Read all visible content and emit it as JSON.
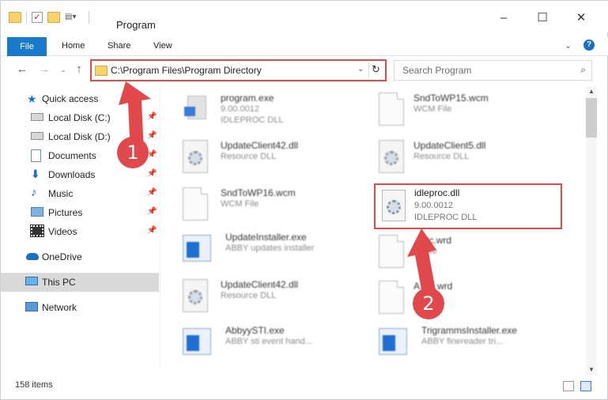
{
  "window": {
    "title": "Program",
    "controls": {
      "minimize": "–",
      "maximize": "☐",
      "close": "✕"
    }
  },
  "ribbon": {
    "tabs": [
      "File",
      "Home",
      "Share",
      "View"
    ],
    "help": "?"
  },
  "address": {
    "path": "C:\\Program Files\\Program Directory"
  },
  "search": {
    "placeholder": "Search Program"
  },
  "sidebar": {
    "items": [
      {
        "label": "Quick access",
        "icon": "star-icon"
      },
      {
        "label": "Local Disk (C:)",
        "icon": "drive-icon",
        "pinned": true
      },
      {
        "label": "Local Disk (D:)",
        "icon": "drive-icon",
        "pinned": true
      },
      {
        "label": "Documents",
        "icon": "documents-icon",
        "pinned": true
      },
      {
        "label": "Downloads",
        "icon": "downloads-icon",
        "pinned": true
      },
      {
        "label": "Music",
        "icon": "music-icon",
        "pinned": true
      },
      {
        "label": "Pictures",
        "icon": "pictures-icon",
        "pinned": true
      },
      {
        "label": "Videos",
        "icon": "videos-icon",
        "pinned": true
      },
      {
        "label": "OneDrive",
        "icon": "cloud-icon"
      },
      {
        "label": "This PC",
        "icon": "computer-icon",
        "selected": true
      },
      {
        "label": "Network",
        "icon": "network-icon"
      }
    ]
  },
  "files": [
    {
      "name": "program.exe",
      "line1": "9.00.0012",
      "line2": "IDLEPROC DLL",
      "icon": "exe-icon"
    },
    {
      "name": "SndToWP15.wcm",
      "line1": "WCM File",
      "line2": "",
      "icon": "document-icon"
    },
    {
      "name": "UpdateClient42.dll",
      "line1": "Resource DLL",
      "line2": "",
      "icon": "dll-icon"
    },
    {
      "name": "UpdateClient5.dll",
      "line1": "Resource DLL",
      "line2": "",
      "icon": "dll-icon"
    },
    {
      "name": "SndToWP16.wcm",
      "line1": "WCM File",
      "line2": "",
      "icon": "document-icon"
    },
    {
      "name": "UpdateInstaller.exe",
      "line1": "ABBY updates installer",
      "line2": "",
      "icon": "app-icon"
    },
    {
      "name": "...pic.wrd",
      "line1": "... File",
      "line2": "",
      "icon": "document-icon"
    },
    {
      "name": "UpdateClient42.dll",
      "line1": "Resource DLL",
      "line2": "",
      "icon": "dll-icon"
    },
    {
      "name": "A...ic.wrd",
      "line1": "",
      "line2": "",
      "icon": "document-icon"
    },
    {
      "name": "AbbyySTI.exe",
      "line1": "ABBY sti event hand...",
      "line2": "",
      "icon": "app-icon"
    },
    {
      "name": "TrigrammsInstaller.exe",
      "line1": "ABBY finereader tri...",
      "line2": "",
      "icon": "app-icon"
    }
  ],
  "highlighted_file": {
    "name": "idleproc.dll",
    "version": "9.00.0012",
    "description": "IDLEPROC DLL",
    "icon": "dll-icon"
  },
  "status": {
    "item_count": "158 items"
  },
  "annotations": {
    "marker1": "1",
    "marker2": "2"
  }
}
